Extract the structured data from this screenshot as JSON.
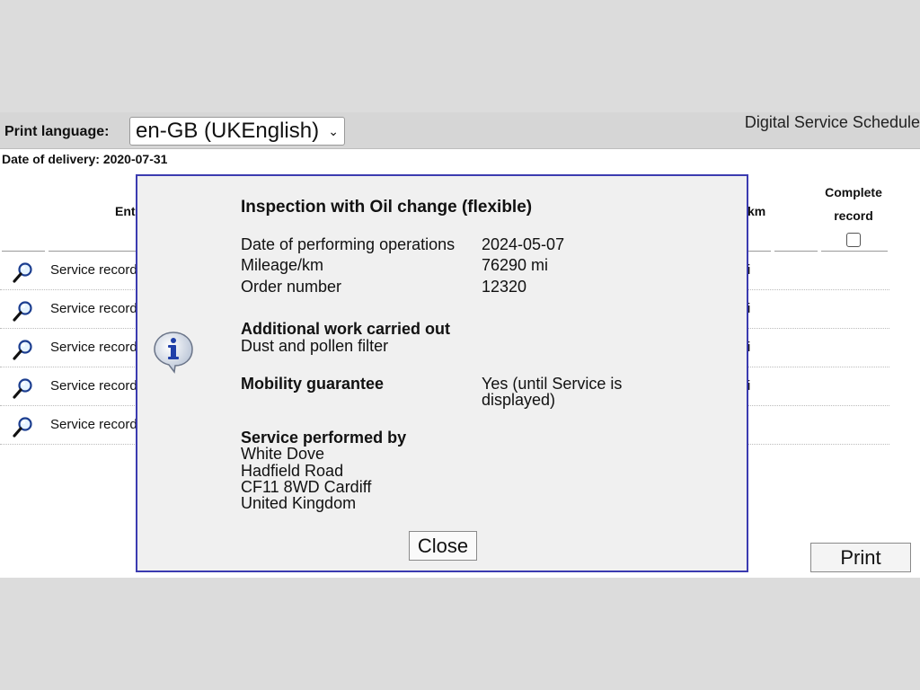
{
  "header": {
    "print_language_label": "Print language:",
    "print_language_value": "en-GB (UKEnglish)",
    "app_title": "Digital Service Schedule"
  },
  "delivery": {
    "text": "Date of delivery: 2020-07-31"
  },
  "table": {
    "col_entry": "Ent",
    "col_km": "km",
    "col_complete_line1": "Complete",
    "col_complete_line2": "record",
    "rows": [
      {
        "label": "Service record",
        "mileage": "i"
      },
      {
        "label": "Service record",
        "mileage": "i"
      },
      {
        "label": "Service record",
        "mileage": "i"
      },
      {
        "label": "Service record",
        "mileage": "i"
      },
      {
        "label": "Service record",
        "mileage": ""
      }
    ]
  },
  "print_button": "Print",
  "dialog": {
    "title": "Inspection with Oil change (flexible)",
    "date_label": "Date of performing operations",
    "date_value": "2024-05-07",
    "mileage_label": "Mileage/km",
    "mileage_value": "76290 mi",
    "order_label": "Order number",
    "order_value": "12320",
    "additional_title": "Additional work carried out",
    "additional_value": "Dust and pollen filter",
    "mobility_label": "Mobility guarantee",
    "mobility_value_line1": "Yes (until Service is",
    "mobility_value_line2": "displayed)",
    "performed_title": "Service performed by",
    "performed_line1": "White Dove",
    "performed_line2": "Hadfield Road",
    "performed_line3": "CF11 8WD Cardiff",
    "performed_line4": "United Kingdom",
    "close_button": "Close"
  },
  "icons": {
    "magnifier": "magnifier-icon",
    "info": "info-icon",
    "dropdown": "chevron-down-icon"
  }
}
